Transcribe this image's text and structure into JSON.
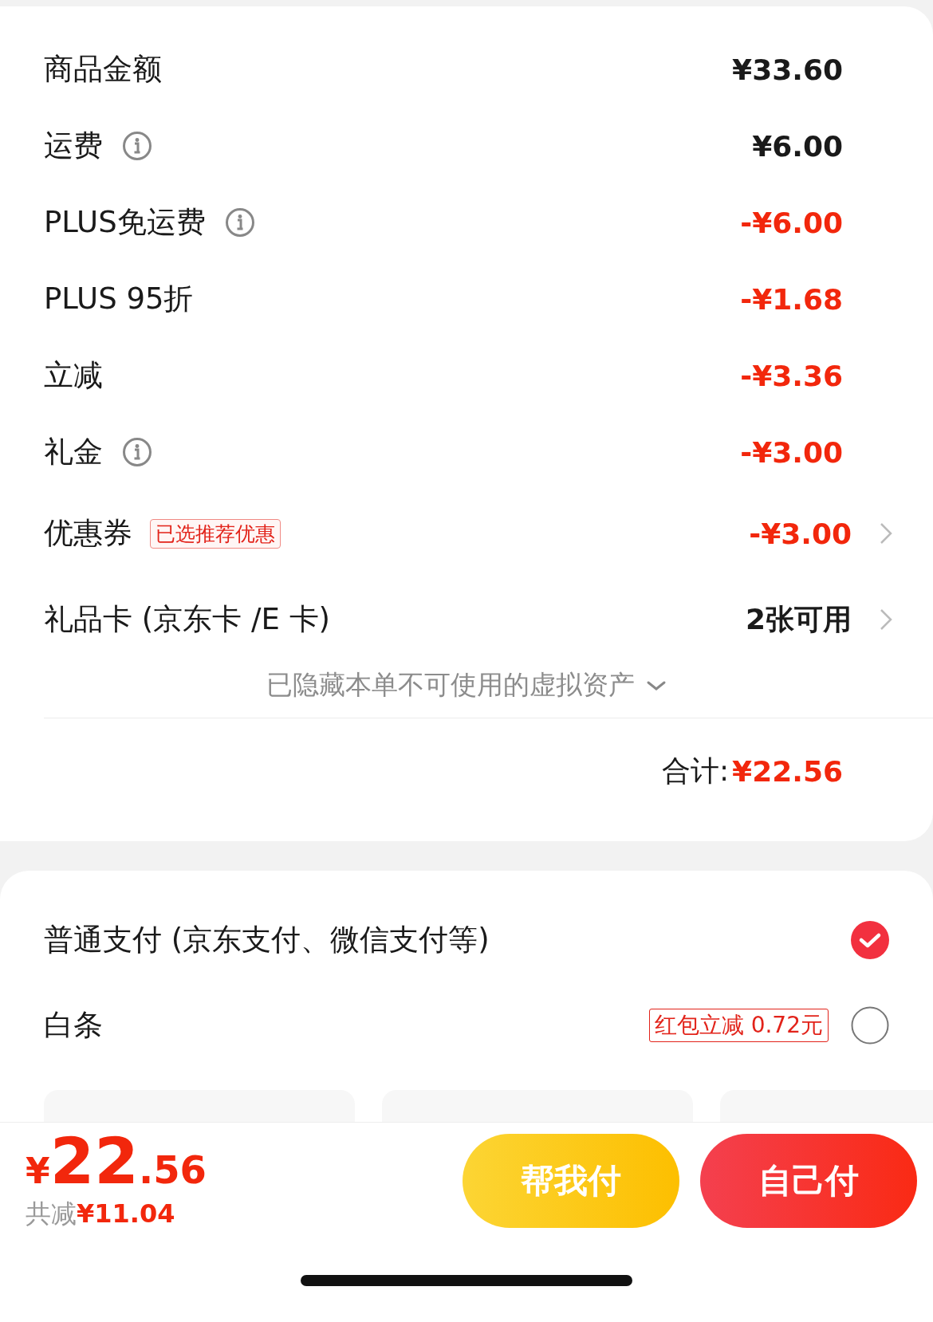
{
  "summary": {
    "rows": [
      {
        "kind": "amount",
        "label": "商品金额",
        "info": false,
        "value": "¥33.60",
        "discount": false
      },
      {
        "kind": "amount",
        "label": "运费",
        "info": true,
        "value": "¥6.00",
        "discount": false
      },
      {
        "kind": "amount",
        "label": "PLUS免运费",
        "info": true,
        "value": "-¥6.00",
        "discount": true
      },
      {
        "kind": "amount",
        "label": "PLUS 95折",
        "info": false,
        "value": "-¥1.68",
        "discount": true
      },
      {
        "kind": "amount",
        "label": "立减",
        "info": false,
        "value": "-¥3.36",
        "discount": true
      },
      {
        "kind": "amount",
        "label": "礼金",
        "info": true,
        "value": "-¥3.00",
        "discount": true
      },
      {
        "kind": "link",
        "label": "优惠券",
        "info": false,
        "tag": "已选推荐优惠",
        "value": "-¥3.00",
        "discount": true
      },
      {
        "kind": "link",
        "label": "礼品卡 (京东卡 /E 卡)",
        "info": false,
        "value": "2张可用",
        "discount": false
      }
    ],
    "hidden_note": "已隐藏本单不可使用的虚拟资产",
    "total_label": "合计:",
    "total": "¥22.56"
  },
  "payment": {
    "options": [
      {
        "label": "普通支付 (京东支付、微信支付等)",
        "selected": true
      },
      {
        "label": "白条",
        "tag": "红包立减 0.72元",
        "selected": false
      }
    ]
  },
  "bottom_bar": {
    "currency": "¥",
    "price_int": "22",
    "price_dec": ".56",
    "saved_label": "共减",
    "saved": "¥11.04",
    "buttons": [
      {
        "label": "帮我付",
        "kind": "secondary"
      },
      {
        "label": "自己付",
        "kind": "primary"
      }
    ]
  }
}
